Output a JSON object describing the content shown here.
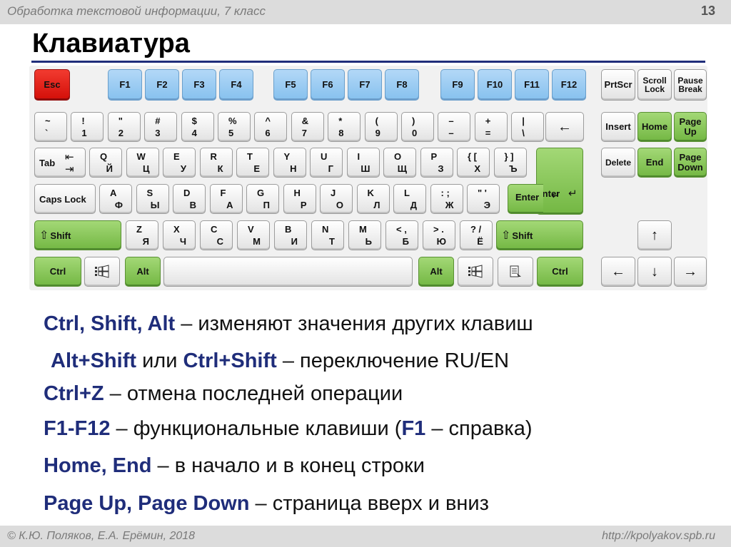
{
  "header": {
    "course": "Обработка текстовой информации, 7 класс",
    "page": "13"
  },
  "title": "Клавиатура",
  "footer": {
    "authors": "© К.Ю. Поляков, Е.А. Ерёмин, 2018",
    "site": "http://kpolyakov.spb.ru"
  },
  "keys": {
    "esc": "Esc",
    "f1": "F1",
    "f2": "F2",
    "f3": "F3",
    "f4": "F4",
    "f5": "F5",
    "f6": "F6",
    "f7": "F7",
    "f8": "F8",
    "f9": "F9",
    "f10": "F10",
    "f11": "F11",
    "f12": "F12",
    "prtscr": "PrtScr",
    "scroll_lock": "Scroll Lock",
    "pause_break": "Pause Break",
    "digits": [
      {
        "top": "~",
        "bot": "`"
      },
      {
        "top": "!",
        "bot": "1"
      },
      {
        "top": "\"",
        "bot": "2"
      },
      {
        "top": "#",
        "bot": "3"
      },
      {
        "top": "$",
        "bot": "4"
      },
      {
        "top": "%",
        "bot": "5"
      },
      {
        "top": "^",
        "bot": "6"
      },
      {
        "top": "&",
        "bot": "7"
      },
      {
        "top": "*",
        "bot": "8"
      },
      {
        "top": "(",
        "bot": "9"
      },
      {
        "top": ")",
        "bot": "0"
      },
      {
        "top": "–",
        "bot": "–"
      },
      {
        "top": "+",
        "bot": "="
      },
      {
        "top": "|",
        "bot": "\\"
      }
    ],
    "backspace": "←",
    "insert": "Insert",
    "home": "Home",
    "page_up": "Page Up",
    "tab": "Tab",
    "row_q": [
      {
        "en": "Q",
        "ru": "Й"
      },
      {
        "en": "W",
        "ru": "Ц"
      },
      {
        "en": "E",
        "ru": "У"
      },
      {
        "en": "R",
        "ru": "К"
      },
      {
        "en": "T",
        "ru": "Е"
      },
      {
        "en": "Y",
        "ru": "Н"
      },
      {
        "en": "U",
        "ru": "Г"
      },
      {
        "en": "I",
        "ru": "Ш"
      },
      {
        "en": "O",
        "ru": "Щ"
      },
      {
        "en": "P",
        "ru": "З"
      },
      {
        "en": "{ [",
        "ru": "Х"
      },
      {
        "en": "} ]",
        "ru": "Ъ"
      }
    ],
    "delete": "Delete",
    "end": "End",
    "page_down": "Page Down",
    "caps_lock": "Caps Lock",
    "row_a": [
      {
        "en": "A",
        "ru": "Ф"
      },
      {
        "en": "S",
        "ru": "Ы"
      },
      {
        "en": "D",
        "ru": "В"
      },
      {
        "en": "F",
        "ru": "А"
      },
      {
        "en": "G",
        "ru": "П"
      },
      {
        "en": "H",
        "ru": "Р"
      },
      {
        "en": "J",
        "ru": "О"
      },
      {
        "en": "K",
        "ru": "Л"
      },
      {
        "en": "L",
        "ru": "Д"
      },
      {
        "en": ": ;",
        "ru": "Ж"
      },
      {
        "en": "\" '",
        "ru": "Э"
      }
    ],
    "enter": "Enter",
    "shift": "Shift",
    "row_z": [
      {
        "en": "Z",
        "ru": "Я"
      },
      {
        "en": "X",
        "ru": "Ч"
      },
      {
        "en": "C",
        "ru": "С"
      },
      {
        "en": "V",
        "ru": "М"
      },
      {
        "en": "B",
        "ru": "И"
      },
      {
        "en": "N",
        "ru": "Т"
      },
      {
        "en": "M",
        "ru": "Ь"
      },
      {
        "en": "< ,",
        "ru": "Б"
      },
      {
        "en": "> .",
        "ru": "Ю"
      },
      {
        "en": "? /",
        "ru": "Ё"
      }
    ],
    "ctrl": "Ctrl",
    "alt": "Alt",
    "arrow_up": "↑",
    "arrow_left": "←",
    "arrow_down": "↓",
    "arrow_right": "→"
  },
  "descriptions": [
    {
      "bold": "Ctrl, Shift, Alt",
      "text": " – изменяют значения других клавиш"
    },
    {
      "bold": "Alt+Shift",
      "mid": " или ",
      "bold2": "Ctrl+Shift",
      "text": " – переключение RU/EN"
    },
    {
      "bold": "Ctrl+Z",
      "text": " – отмена последней операции"
    },
    {
      "bold": "F1-F12",
      "mid": " – функциональные клавиши (",
      "bold2": "F1",
      "text": " – справка)"
    },
    {
      "bold": "Home, End",
      "text": " – в начало и в конец строки"
    },
    {
      "bold": "Page Up, Page Down",
      "text": " – страница вверх и вниз"
    }
  ]
}
